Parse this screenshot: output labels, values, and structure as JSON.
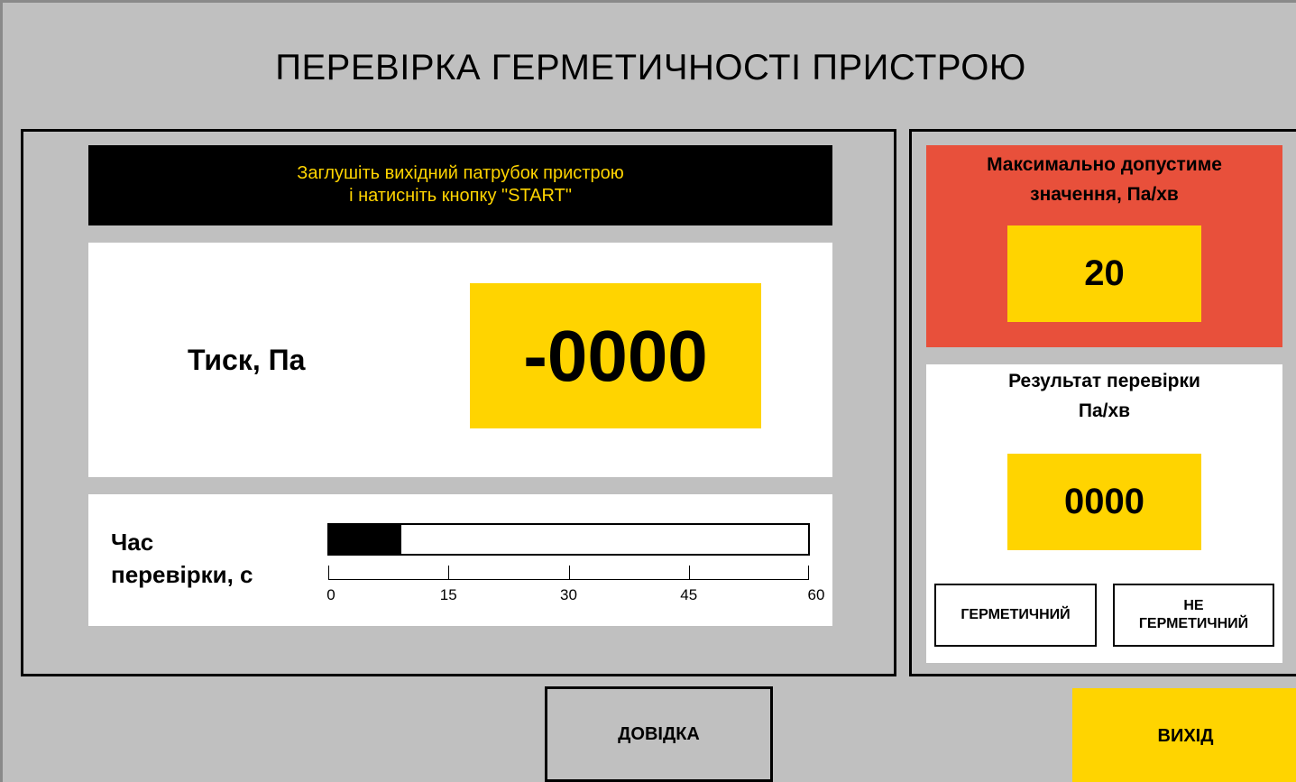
{
  "page_title": "ПЕРЕВІРКА ГЕРМЕТИЧНОСТІ ПРИСТРОЮ",
  "instruction": {
    "line1": "Заглушіть вихідний патрубок пристрою",
    "line2": "і натисніть кнопку \"START\""
  },
  "pressure": {
    "label": "Тиск, Па",
    "value": "-0000"
  },
  "timer": {
    "label_line1": "Час",
    "label_line2": "перевірки, с",
    "progress_seconds": 9,
    "scale_min": 0,
    "scale_max": 60,
    "ticks": [
      "0",
      "15",
      "30",
      "45",
      "60"
    ]
  },
  "limit": {
    "title_line1": "Максимально допустиме",
    "title_line2": "значення, Па/хв",
    "value": "20"
  },
  "result": {
    "title_line1": "Результат перевірки",
    "title_line2": "Па/хв",
    "value": "0000",
    "sealed_label": "ГЕРМЕТИЧНИЙ",
    "unsealed_line1": "НЕ",
    "unsealed_line2": "ГЕРМЕТИЧНИЙ"
  },
  "buttons": {
    "help": "ДОВІДКА",
    "exit": "ВИХІД"
  },
  "colors": {
    "background": "#c0c0c0",
    "accent_yellow": "#ffd400",
    "alert_red": "#e8503b",
    "instruction_text": "#ffd400"
  }
}
